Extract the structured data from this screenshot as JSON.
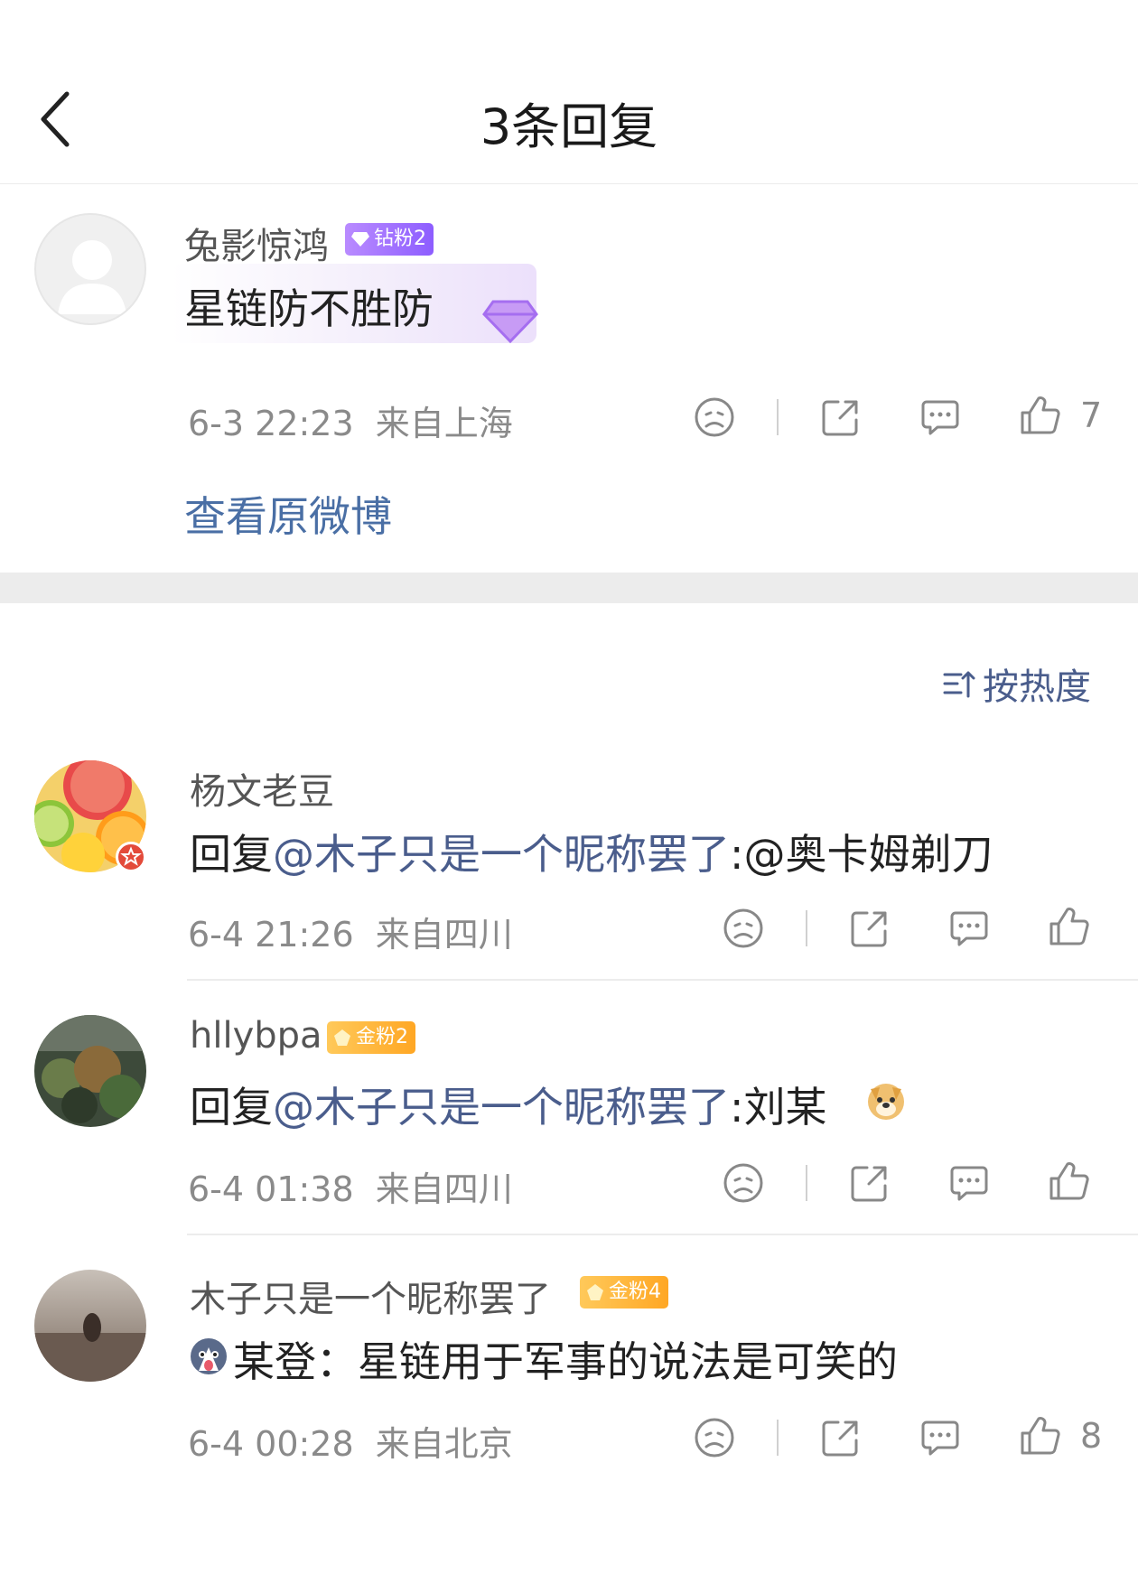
{
  "header": {
    "title": "3条回复"
  },
  "main_comment": {
    "username": "兔影惊鸿",
    "badge": "钻粉2",
    "text": "星链防不胜防",
    "time": "6-3 22:23",
    "location": "来自上海",
    "likes": "7",
    "view_original": "查看原微博"
  },
  "sort": {
    "label": "按热度"
  },
  "replies": [
    {
      "username": "杨文老豆",
      "badge": "",
      "prefix": "回复",
      "mention": "@木子只是一个昵称罢了",
      "rest": ":@奥卡姆剃刀",
      "time": "6-4 21:26",
      "location": "来自四川",
      "likes": ""
    },
    {
      "username": "hllybpa",
      "badge": "金粉2",
      "prefix": "回复",
      "mention": "@木子只是一个昵称罢了",
      "rest": ":刘某",
      "time": "6-4 01:38",
      "location": "来自四川",
      "likes": ""
    },
    {
      "username": "木子只是一个昵称罢了",
      "badge": "金粉4",
      "text": "某登：星链用于军事的说法是可笑的",
      "time": "6-4 00:28",
      "location": "来自北京",
      "likes": "8"
    }
  ],
  "colors": {
    "link": "#4a6fa5",
    "mention": "#4a5d8c",
    "meta": "#8a8a8a"
  }
}
